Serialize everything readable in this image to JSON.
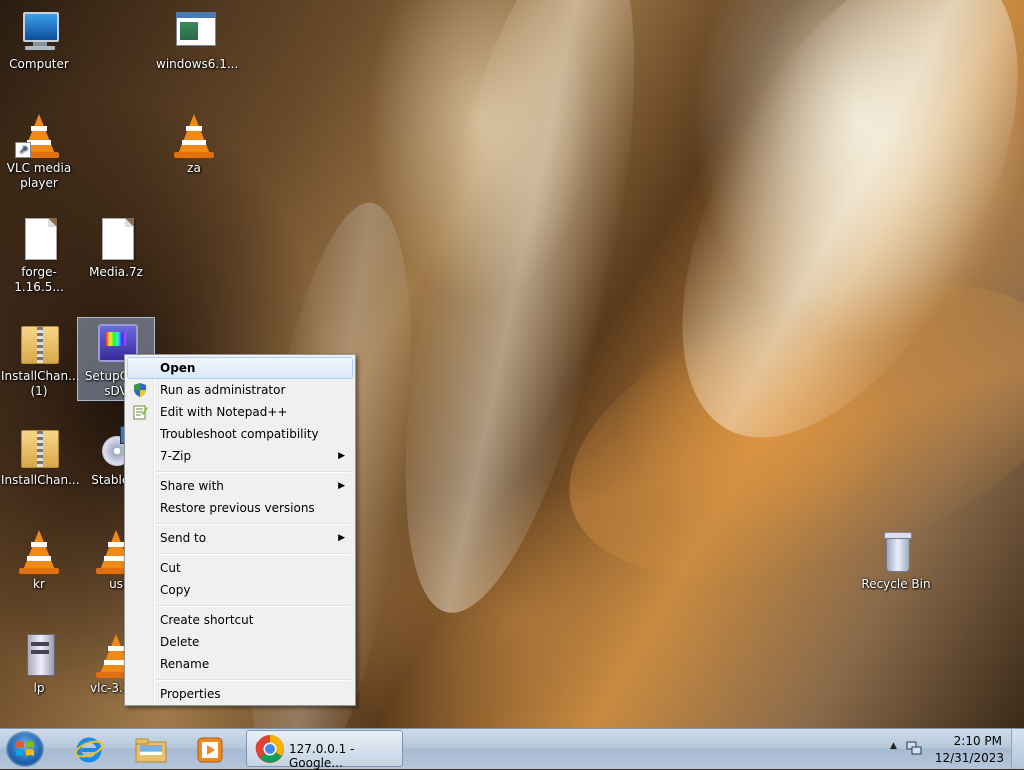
{
  "desktop": {
    "icons": [
      {
        "label": "Computer"
      },
      {
        "label": "windows6.1..."
      },
      {
        "label": "VLC media player"
      },
      {
        "label": "za"
      },
      {
        "label": "forge-1.16.5..."
      },
      {
        "label": "Media.7z"
      },
      {
        "label": "InstallChan... (1)"
      },
      {
        "label": "SetupCh... sDV"
      },
      {
        "label": "InstallChan..."
      },
      {
        "label": "StableBi"
      },
      {
        "label": "kr"
      },
      {
        "label": "us"
      },
      {
        "label": "lp"
      },
      {
        "label": "vlc-3.0.2"
      },
      {
        "label": "Recycle Bin"
      }
    ]
  },
  "context_menu": {
    "items": [
      {
        "label": "Open"
      },
      {
        "label": "Run as administrator"
      },
      {
        "label": "Edit with Notepad++"
      },
      {
        "label": "Troubleshoot compatibility"
      },
      {
        "label": "7-Zip"
      },
      {
        "label": "Share with"
      },
      {
        "label": "Restore previous versions"
      },
      {
        "label": "Send to"
      },
      {
        "label": "Cut"
      },
      {
        "label": "Copy"
      },
      {
        "label": "Create shortcut"
      },
      {
        "label": "Delete"
      },
      {
        "label": "Rename"
      },
      {
        "label": "Properties"
      }
    ],
    "submenu_arrow": "▶"
  },
  "taskbar": {
    "chrome_task_label": "127.0.0.1 - Google...",
    "tray_arrow": "▲",
    "clock_time": "2:10 PM",
    "clock_date": "12/31/2023"
  },
  "colors": {
    "vlc_orange": "#f08a14",
    "menu_bg": "#f0f0f0",
    "highlight_border": "#aecff7"
  }
}
